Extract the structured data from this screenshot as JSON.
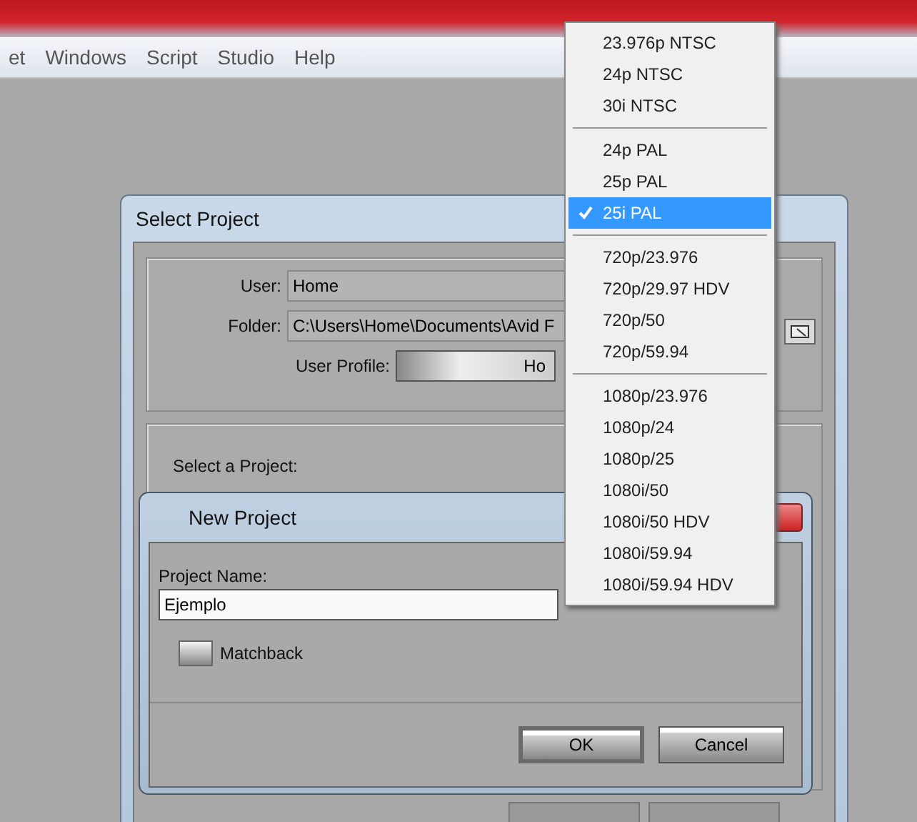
{
  "menu_bar": {
    "items": [
      "et",
      "Windows",
      "Script",
      "Studio",
      "Help"
    ]
  },
  "select_project": {
    "title": "Select Project",
    "user_label": "User:",
    "user_value": "Home",
    "folder_label": "Folder:",
    "folder_value": "C:\\Users\\Home\\Documents\\Avid F",
    "profile_label": "User Profile:",
    "profile_value": "Ho",
    "select_label": "Select a Project:"
  },
  "new_project": {
    "title": "New Project",
    "name_label": "Project Name:",
    "name_value": "Ejemplo",
    "matchback": {
      "label": "Matchback",
      "checked": false
    },
    "buttons": [
      {
        "label": "OK",
        "default": true
      },
      {
        "label": "Cancel",
        "default": false
      }
    ]
  },
  "format_menu": {
    "groups": [
      {
        "items": [
          {
            "label": "23.976p NTSC",
            "selected": false
          },
          {
            "label": "24p NTSC",
            "selected": false
          },
          {
            "label": "30i NTSC",
            "selected": false
          }
        ]
      },
      {
        "items": [
          {
            "label": "24p PAL",
            "selected": false
          },
          {
            "label": "25p PAL",
            "selected": false
          },
          {
            "label": "25i PAL",
            "selected": true
          }
        ]
      },
      {
        "items": [
          {
            "label": "720p/23.976",
            "selected": false
          },
          {
            "label": "720p/29.97 HDV",
            "selected": false
          },
          {
            "label": "720p/50",
            "selected": false
          },
          {
            "label": "720p/59.94",
            "selected": false
          }
        ]
      },
      {
        "items": [
          {
            "label": "1080p/23.976",
            "selected": false
          },
          {
            "label": "1080p/24",
            "selected": false
          },
          {
            "label": "1080p/25",
            "selected": false
          },
          {
            "label": "1080i/50",
            "selected": false
          },
          {
            "label": "1080i/50 HDV",
            "selected": false
          },
          {
            "label": "1080i/59.94",
            "selected": false
          },
          {
            "label": "1080i/59.94 HDV",
            "selected": false
          }
        ]
      }
    ]
  }
}
